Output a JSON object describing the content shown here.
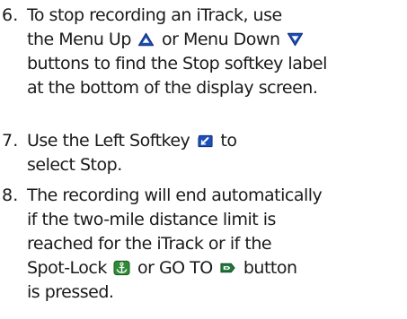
{
  "steps": [
    {
      "number": "6.",
      "lines": [
        "To stop recording an iTrack, use",
        "the Menu Up",
        "or Menu Down",
        "buttons to find the Stop softkey label",
        "at the bottom of the display screen."
      ]
    },
    {
      "number": "7.",
      "lines": [
        "Use the Left Softkey",
        "select Stop.",
        "to"
      ]
    },
    {
      "number": "8.",
      "lines": [
        "The recording will end automatically",
        "if the two-mile distance limit is",
        "reached for the iTrack or if the",
        "Spot-Lock",
        "or GO TO",
        "button",
        "is pressed."
      ]
    }
  ],
  "icons": {
    "menu_up": "menu-up-triangle-icon",
    "menu_down": "menu-down-triangle-icon",
    "left_softkey": "left-softkey-icon",
    "spot_lock": "spot-lock-anchor-icon",
    "go_to": "go-to-icon"
  },
  "colors": {
    "text": "#1a1a1a",
    "menu_icon_fill": "#1e4fb8",
    "softkey_icon_fill": "#1e4fb8",
    "spot_lock_fill": "#2f8a36",
    "go_to_fill": "#22773a"
  }
}
